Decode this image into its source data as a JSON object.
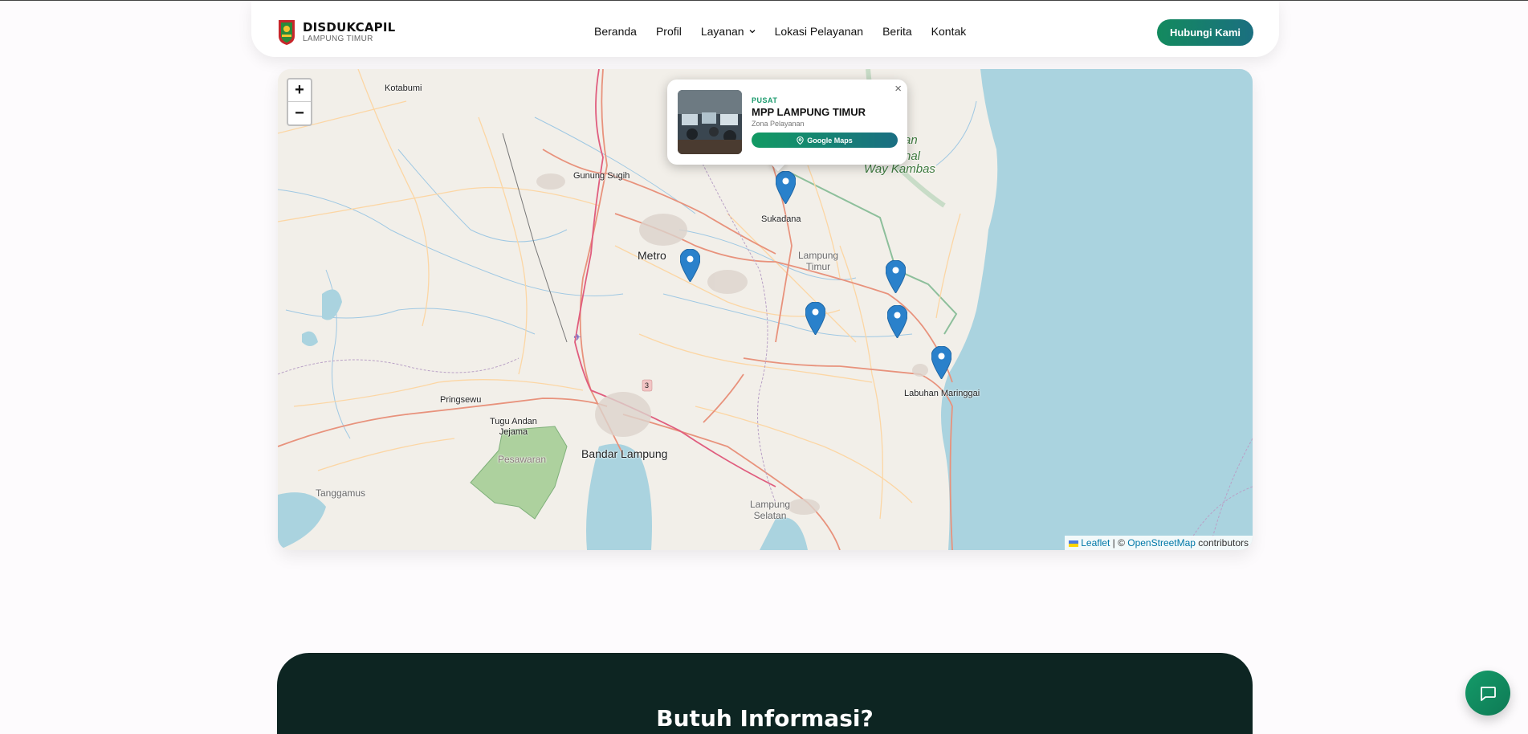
{
  "header": {
    "brand_title": "DISDUKCAPIL",
    "brand_sub": "LAMPUNG TIMUR",
    "nav": [
      "Beranda",
      "Profil",
      "Layanan",
      "Lokasi Pelayanan",
      "Berita",
      "Kontak"
    ],
    "cta_label": "Hubungi Kami"
  },
  "map": {
    "zoom_in": "+",
    "zoom_out": "−",
    "labels": {
      "kotabumi": "Kotabumi",
      "gunung_sugih": "Gunung Sugih",
      "metro": "Metro",
      "sukadana": "Sukadana",
      "lampung_timur": "Lampung\nTimur",
      "park_1": "an",
      "park_2": "nal",
      "park_3": "Way Kambas",
      "pringsewu": "Pringsewu",
      "tugu": "Tugu Andan\nJejama",
      "pesawaran": "Pesawaran",
      "bandar_lampung": "Bandar Lampung",
      "tanggamus": "Tanggamus",
      "lampung_selatan": "Lampung\nSelatan",
      "labuhan": "Labuhan Maringgai",
      "road_3": "3"
    },
    "attribution": {
      "leaflet": "Leaflet",
      "sep": " | © ",
      "osm": "OpenStreetMap",
      "contrib": " contributors"
    },
    "colors": {
      "marker": "#2a81cb",
      "sea": "#aad3df",
      "land": "#f2efe9",
      "park": "#add19e"
    }
  },
  "popup": {
    "category": "PUSAT",
    "title": "MPP LAMPUNG TIMUR",
    "subtitle": "Zona Pelayanan",
    "button_label": "Google Maps",
    "close": "×"
  },
  "info": {
    "title": "Butuh Informasi?"
  }
}
